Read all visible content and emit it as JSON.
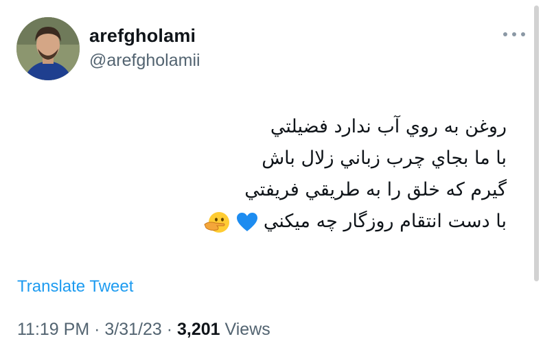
{
  "user": {
    "display_name": "arefgholami",
    "handle": "@arefgholamii"
  },
  "menu": {
    "icon": "more-dots-icon"
  },
  "tweet": {
    "lines": [
      "روغن به روي آب ندارد فضيلتي",
      "با ما بجاي چرب زباني زلال باش",
      "گيرم كه خلق را به طريقي فريفتي",
      "با دست انتقام روزگار چه ميكني"
    ],
    "emojis": [
      "blue-heart-icon",
      "face-with-hand-over-mouth-icon"
    ]
  },
  "translate_label": "Translate Tweet",
  "meta": {
    "time": "11:19 PM",
    "separator": " · ",
    "date": "3/31/23",
    "views_count": "3,201",
    "views_label": " Views"
  },
  "colors": {
    "primary_text": "#0f1419",
    "secondary_text": "#536471",
    "link": "#1d9bf0",
    "heart": "#1d8cf0"
  }
}
